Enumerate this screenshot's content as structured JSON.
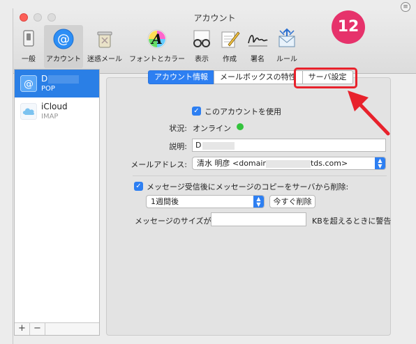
{
  "window": {
    "title": "アカウント"
  },
  "toolbar": {
    "items": [
      {
        "label": "一般",
        "icon": "switch-icon"
      },
      {
        "label": "アカウント",
        "icon": "at-sign-icon"
      },
      {
        "label": "迷惑メール",
        "icon": "trash-can-icon"
      },
      {
        "label": "フォントとカラー",
        "icon": "font-a-icon"
      },
      {
        "label": "表示",
        "icon": "glasses-icon"
      },
      {
        "label": "作成",
        "icon": "compose-pen-icon"
      },
      {
        "label": "署名",
        "icon": "signature-icon"
      },
      {
        "label": "ルール",
        "icon": "rules-envelope-icon"
      }
    ]
  },
  "sidebar": {
    "accounts": [
      {
        "name": "D",
        "type": "POP"
      },
      {
        "name": "iCloud",
        "type": "IMAP"
      }
    ],
    "add": "+",
    "remove": "−"
  },
  "tabs": [
    "アカウント情報",
    "メールボックスの特性",
    "サーバ設定"
  ],
  "form": {
    "enable_label": "このアカウントを使用",
    "status_label": "状況:",
    "status_value": "オンライン",
    "desc_label": "説明:",
    "desc_value": "D",
    "email_label": "メールアドレス:",
    "email_value_start": "清水 明彦 <domair",
    "email_value_end": "tds.com>",
    "delete_label": "メッセージ受信後にメッセージのコピーをサーバから削除:",
    "period_value": "1週間後",
    "delete_now": "今すぐ削除",
    "size_label": "メッセージのサイズが",
    "size_value": "",
    "size_suffix": "KBを超えるときに警告"
  },
  "annotation": {
    "step": "12"
  },
  "colors": {
    "accent": "#2d7ff2",
    "highlight": "#e8222c",
    "badge": "#e6326b",
    "online": "#33c33d"
  }
}
